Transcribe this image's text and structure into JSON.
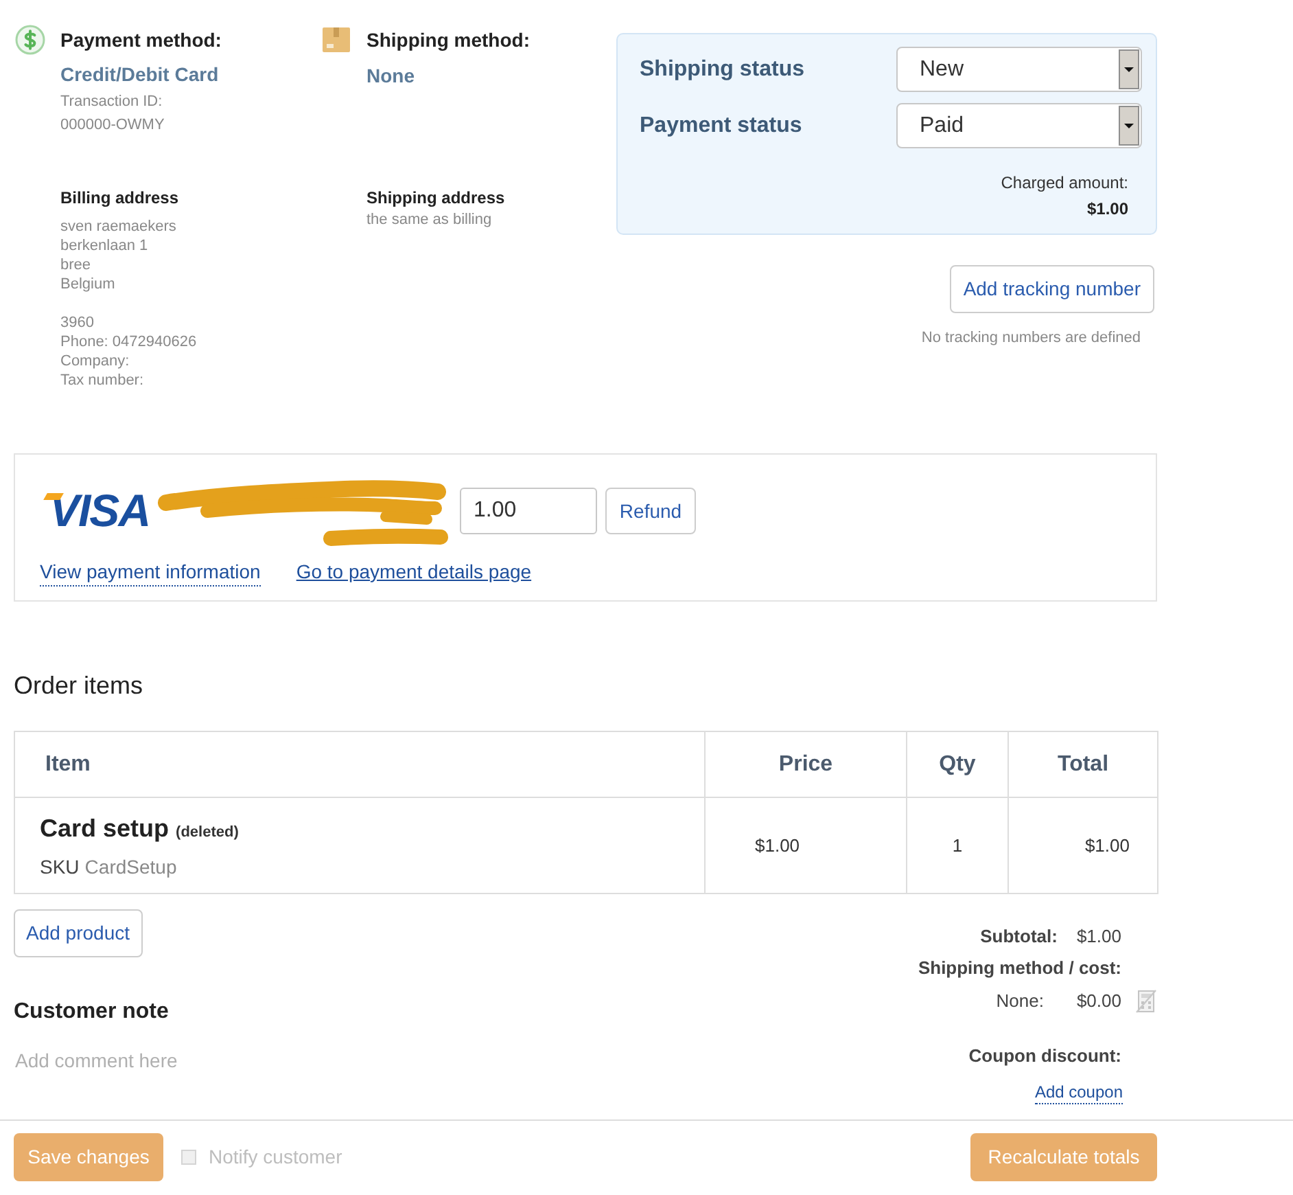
{
  "payment_method": {
    "label": "Payment method:",
    "value": "Credit/Debit Card",
    "transaction_label": "Transaction ID:",
    "transaction_id": "000000-OWMY"
  },
  "shipping_method": {
    "label": "Shipping method:",
    "value": "None"
  },
  "billing_address": {
    "title": "Billing address",
    "address_lines": [
      "sven raemaekers",
      "berkenlaan 1",
      "bree",
      "Belgium"
    ],
    "contact_lines": [
      "3960",
      "Phone: 0472940626",
      "Company:",
      "Tax number:"
    ]
  },
  "shipping_address": {
    "title": "Shipping address",
    "text": "the same as billing"
  },
  "status_panel": {
    "fields": [
      {
        "label": "Shipping status",
        "value": "New"
      },
      {
        "label": "Payment status",
        "value": "Paid"
      }
    ],
    "charged_label": "Charged amount:",
    "charged_amount": "$1.00"
  },
  "tracking": {
    "button": "Add tracking number",
    "note": "No tracking numbers are defined"
  },
  "payment": {
    "card_brand": "VISA",
    "amount": "1.00",
    "refund_button": "Refund",
    "links": [
      {
        "text": "View payment information",
        "kind": "dotted"
      },
      {
        "text": "Go to payment details page",
        "kind": "solid"
      }
    ]
  },
  "order_items": {
    "title": "Order items",
    "columns": [
      "Item",
      "Price",
      "Qty",
      "Total"
    ],
    "rows": [
      {
        "name": "Card setup",
        "note": "(deleted)",
        "sku_label": "SKU",
        "sku": "CardSetup",
        "price": "$1.00",
        "qty": "1",
        "total": "$1.00"
      }
    ]
  },
  "add_product_button": "Add product",
  "totals": {
    "subtotal_label": "Subtotal:",
    "subtotal": "$1.00",
    "shipping_label": "Shipping method / cost:",
    "shipping_method": "None:",
    "shipping_cost": "$0.00",
    "coupon_label": "Coupon discount:",
    "coupon_link": "Add coupon"
  },
  "customer_note": {
    "title": "Customer note",
    "placeholder": "Add comment here"
  },
  "footer": {
    "save_button": {
      "label": "Save changes",
      "disabled": true
    },
    "notify": {
      "label": "Notify customer",
      "checked": false,
      "disabled": true
    },
    "recalculate_button": {
      "label": "Recalculate totals",
      "disabled": true
    }
  }
}
